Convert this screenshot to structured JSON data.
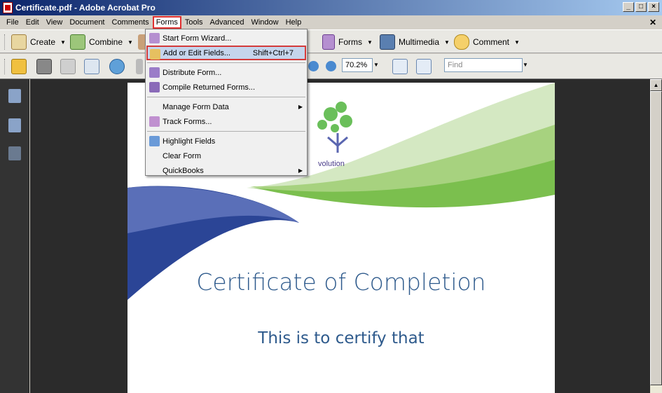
{
  "window": {
    "title": "Certificate.pdf - Adobe Acrobat Pro"
  },
  "menubar": {
    "items": [
      "File",
      "Edit",
      "View",
      "Document",
      "Comments",
      "Forms",
      "Tools",
      "Advanced",
      "Window",
      "Help"
    ],
    "active": "Forms"
  },
  "toolbar1": {
    "create": "Create",
    "combine": "Combine",
    "forms": "Forms",
    "multimedia": "Multimedia",
    "comment": "Comment"
  },
  "toolbar2": {
    "zoom_value": "70.2%",
    "find_placeholder": "Find"
  },
  "forms_menu": {
    "items": [
      {
        "label": "Start Form Wizard...",
        "shortcut": "",
        "submenu": false
      },
      {
        "label": "Add or Edit Fields...",
        "shortcut": "Shift+Ctrl+7",
        "submenu": false,
        "highlighted": true
      },
      {
        "label": "Distribute Form...",
        "shortcut": "",
        "submenu": false
      },
      {
        "label": "Compile Returned Forms...",
        "shortcut": "",
        "submenu": false
      },
      {
        "label": "Manage Form Data",
        "shortcut": "",
        "submenu": true
      },
      {
        "label": "Track Forms...",
        "shortcut": "",
        "submenu": false
      },
      {
        "label": "Highlight Fields",
        "shortcut": "",
        "submenu": false
      },
      {
        "label": "Clear Form",
        "shortcut": "",
        "submenu": false
      },
      {
        "label": "QuickBooks",
        "shortcut": "",
        "submenu": true
      }
    ]
  },
  "document": {
    "logo_text": "volution",
    "title": "Certificate of Completion",
    "subtitle": "This is to certify that"
  },
  "colors": {
    "title_text": "#2e5a8c",
    "wave_blue": "#2b4596",
    "wave_green": "#7bbf4e",
    "menu_highlight_border": "#d43a3a"
  }
}
